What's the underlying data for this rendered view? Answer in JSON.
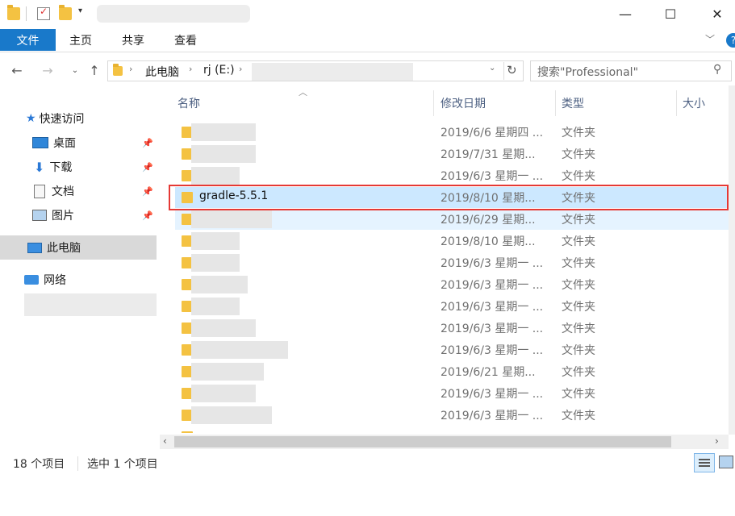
{
  "ribbon": {
    "file": "文件",
    "home": "主页",
    "share": "共享",
    "view": "查看"
  },
  "address": {
    "crumb_pc": "此电脑",
    "crumb_drive": "rj (E:)"
  },
  "search": {
    "placeholder": "搜索\"Professional\""
  },
  "columns": {
    "name": "名称",
    "date": "修改日期",
    "type": "类型",
    "size": "大小"
  },
  "nav": {
    "quick_access": "快速访问",
    "desktop": "桌面",
    "downloads": "下载",
    "documents": "文档",
    "pictures": "图片",
    "this_pc": "此电脑",
    "network": "网络"
  },
  "files": [
    {
      "name": "",
      "date": "2019/6/6 星期四 ...",
      "type": "文件夹"
    },
    {
      "name": "",
      "date": "2019/7/31 星期...",
      "type": "文件夹"
    },
    {
      "name": "",
      "date": "2019/6/3 星期一 ...",
      "type": "文件夹"
    },
    {
      "name": "gradle-5.5.1",
      "date": "2019/8/10 星期...",
      "type": "文件夹"
    },
    {
      "name": "",
      "date": "2019/6/29 星期...",
      "type": "文件夹"
    },
    {
      "name": "",
      "date": "2019/8/10 星期...",
      "type": "文件夹"
    },
    {
      "name": "",
      "date": "2019/6/3 星期一 ...",
      "type": "文件夹"
    },
    {
      "name": "",
      "date": "2019/6/3 星期一 ...",
      "type": "文件夹"
    },
    {
      "name": "",
      "date": "2019/6/3 星期一 ...",
      "type": "文件夹"
    },
    {
      "name": "",
      "date": "2019/6/3 星期一 ...",
      "type": "文件夹"
    },
    {
      "name": "",
      "date": "2019/6/3 星期一 ...",
      "type": "文件夹"
    },
    {
      "name": "",
      "date": "2019/6/21 星期...",
      "type": "文件夹"
    },
    {
      "name": "",
      "date": "2019/6/3 星期一 ...",
      "type": "文件夹"
    },
    {
      "name": "",
      "date": "2019/6/3 星期一 ...",
      "type": "文件夹"
    }
  ],
  "status": {
    "count": "18 个项目",
    "selected": "选中 1 个项目"
  },
  "colors": {
    "accent": "#1979ca",
    "selected_bg": "#cce8ff",
    "highlight_border": "#e53935"
  }
}
